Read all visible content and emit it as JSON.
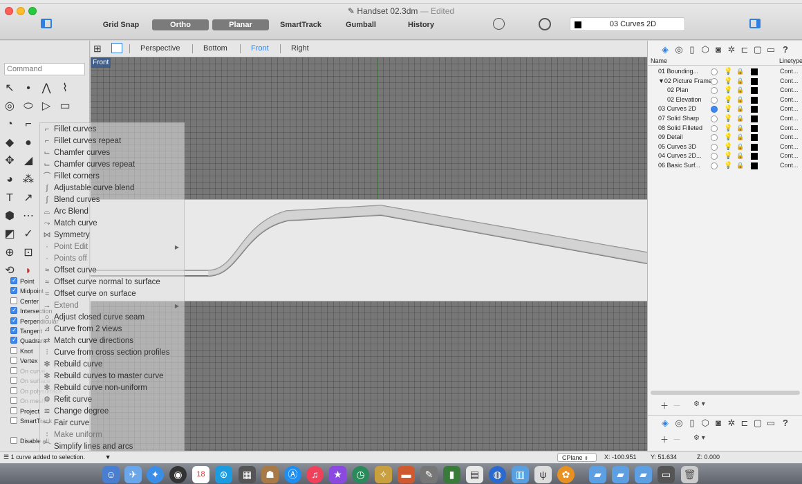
{
  "window": {
    "title": "Handset 02.3dm",
    "edited_label": "— Edited"
  },
  "toolbar": {
    "grid_snap": "Grid Snap",
    "ortho": "Ortho",
    "planar": "Planar",
    "smarttrack": "SmartTrack",
    "gumball": "Gumball",
    "history": "History",
    "current_layer": "03 Curves 2D"
  },
  "command": {
    "placeholder": "Command"
  },
  "viewport_tabs": [
    "Perspective",
    "Bottom",
    "Front",
    "Right"
  ],
  "active_viewport_label": "Front",
  "osnaps": [
    {
      "label": "Point",
      "checked": true,
      "enabled": true
    },
    {
      "label": "Midpoint",
      "checked": true,
      "enabled": true
    },
    {
      "label": "Center",
      "checked": false,
      "enabled": true
    },
    {
      "label": "Intersection",
      "checked": true,
      "enabled": true
    },
    {
      "label": "Perpendicular",
      "checked": true,
      "enabled": true
    },
    {
      "label": "Tangent",
      "checked": true,
      "enabled": true
    },
    {
      "label": "Quadrant",
      "checked": true,
      "enabled": true
    },
    {
      "label": "Knot",
      "checked": false,
      "enabled": true
    },
    {
      "label": "Vertex",
      "checked": false,
      "enabled": true
    },
    {
      "label": "On curve",
      "checked": false,
      "enabled": false
    },
    {
      "label": "On surface",
      "checked": false,
      "enabled": false
    },
    {
      "label": "On polysurface",
      "checked": false,
      "enabled": false
    },
    {
      "label": "On mesh",
      "checked": false,
      "enabled": false
    },
    {
      "label": "Project",
      "checked": false,
      "enabled": true
    },
    {
      "label": "SmartTrack",
      "checked": false,
      "enabled": true
    }
  ],
  "disable_label": "Disable all",
  "flyout_menu": [
    {
      "label": "Fillet curves"
    },
    {
      "label": "Fillet curves repeat"
    },
    {
      "label": "Chamfer curves"
    },
    {
      "label": "Chamfer curves repeat"
    },
    {
      "label": "Fillet corners"
    },
    {
      "label": "Adjustable curve blend"
    },
    {
      "label": "Blend curves"
    },
    {
      "label": "Arc Blend"
    },
    {
      "label": "Match curve"
    },
    {
      "label": "Symmetry"
    },
    {
      "label": "Point Edit",
      "submenu": true
    },
    {
      "label": "Points off"
    },
    {
      "label": "Offset curve"
    },
    {
      "label": "Offset curve normal to surface"
    },
    {
      "label": "Offset curve on surface"
    },
    {
      "label": "Extend",
      "submenu": true
    },
    {
      "label": "Adjust closed curve seam"
    },
    {
      "label": "Curve from 2 views"
    },
    {
      "label": "Match curve directions"
    },
    {
      "label": "Curve from cross section profiles"
    },
    {
      "label": "Rebuild curve"
    },
    {
      "label": "Rebuild curves to master curve"
    },
    {
      "label": "Rebuild curve non-uniform"
    },
    {
      "label": "Refit curve"
    },
    {
      "label": "Change degree"
    },
    {
      "label": "Fair curve"
    },
    {
      "label": "Make uniform"
    },
    {
      "label": "Simplify lines and arcs"
    }
  ],
  "layers": {
    "col_name": "Name",
    "col_linetype": "Linetype",
    "rows": [
      {
        "name": "01 Bounding...",
        "indent": 0,
        "current": false,
        "linetype": "Cont..."
      },
      {
        "name": "▼02 Picture Frame",
        "indent": 0,
        "current": false,
        "linetype": "Cont..."
      },
      {
        "name": "02 Plan",
        "indent": 1,
        "current": false,
        "linetype": "Cont..."
      },
      {
        "name": "02 Elevation",
        "indent": 1,
        "current": false,
        "linetype": "Cont..."
      },
      {
        "name": "03 Curves 2D",
        "indent": 0,
        "current": true,
        "linetype": "Cont..."
      },
      {
        "name": "07 Solid Sharp",
        "indent": 0,
        "current": false,
        "linetype": "Cont..."
      },
      {
        "name": "08 Solid Filleted",
        "indent": 0,
        "current": false,
        "linetype": "Cont..."
      },
      {
        "name": "09 Detail",
        "indent": 0,
        "current": false,
        "linetype": "Cont..."
      },
      {
        "name": "05 Curves 3D",
        "indent": 0,
        "current": false,
        "linetype": "Cont..."
      },
      {
        "name": "04 Curves 2D...",
        "indent": 0,
        "current": false,
        "linetype": "Cont..."
      },
      {
        "name": "06 Basic Surf...",
        "indent": 0,
        "current": false,
        "linetype": "Cont..."
      }
    ]
  },
  "status": {
    "message": "1 curve added to selection.",
    "cplane": "CPlane",
    "x": "X: -100.951",
    "y": "Y: 51.634",
    "z": "Z: 0.000"
  },
  "dock_calendar_day": "18",
  "colors": {
    "accent": "#2f7fe0",
    "viewport_bg": "#777777",
    "active_label": "#3f5f8a"
  }
}
